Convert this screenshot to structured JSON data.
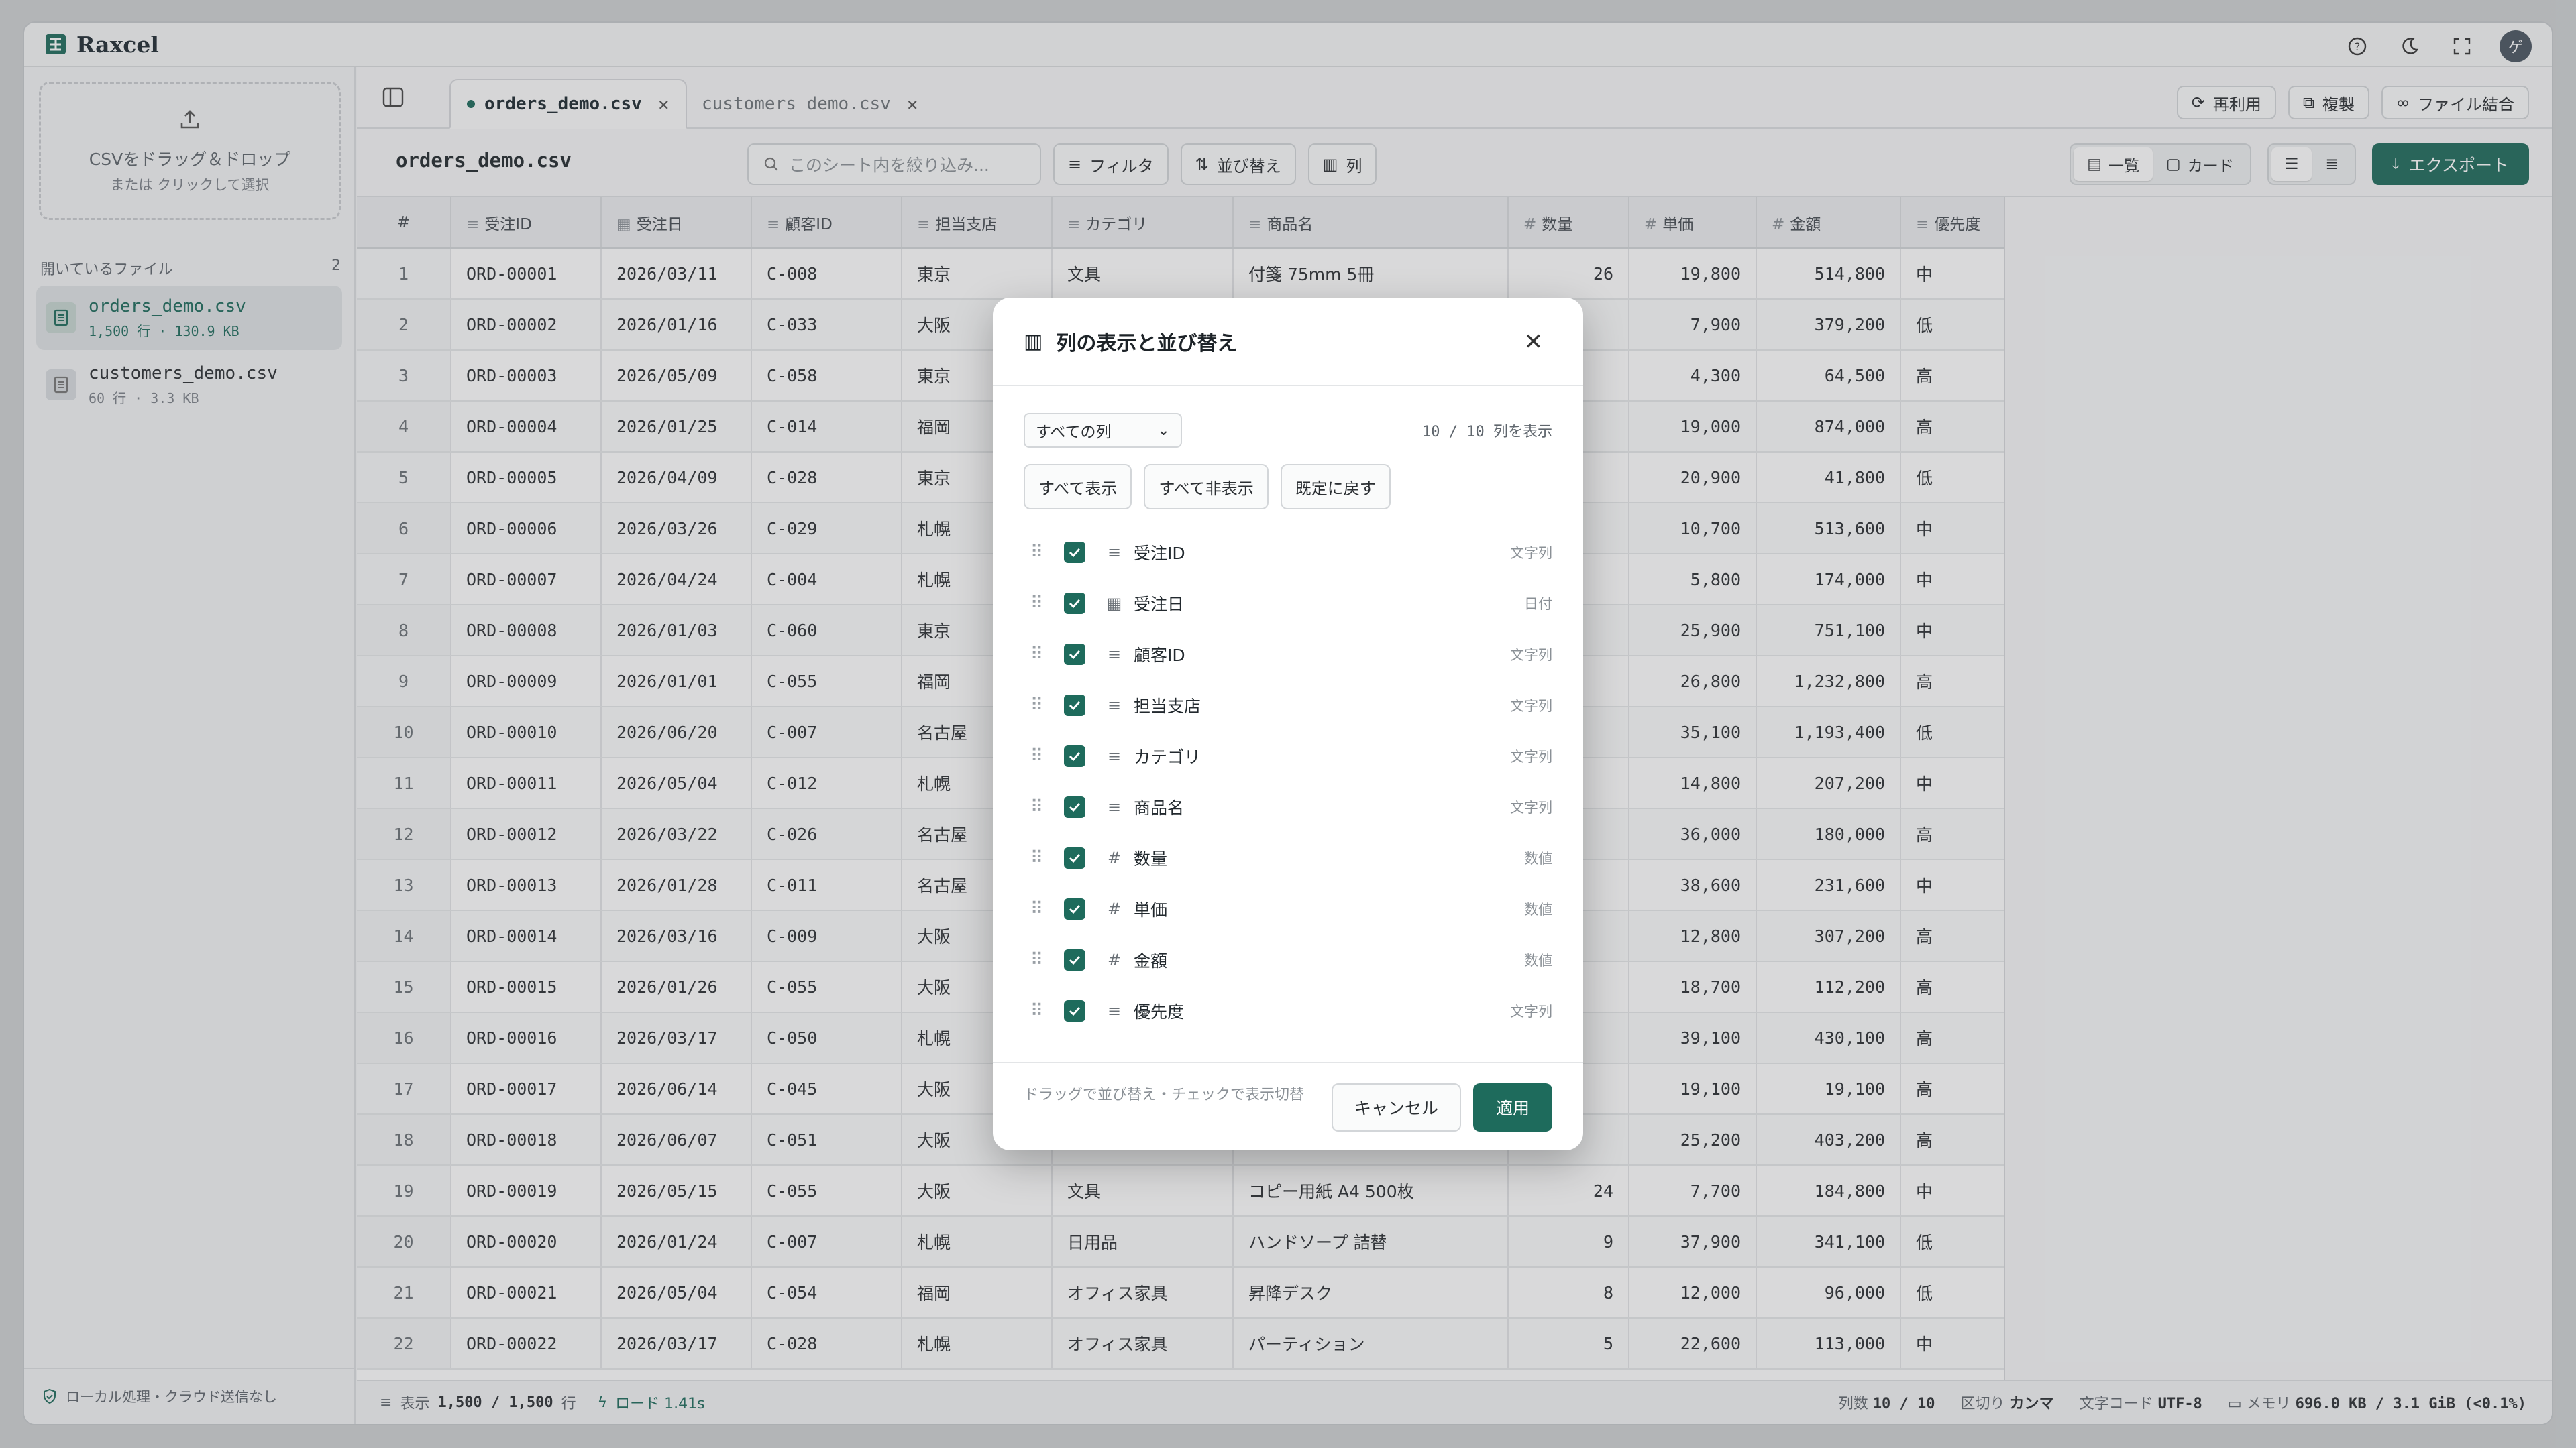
{
  "app": {
    "title": "Raxcel"
  },
  "sidebar": {
    "drop_title": "CSVをドラッグ＆ドロップ",
    "drop_sub": "または クリックして選択",
    "open_files_label": "開いているファイル",
    "open_files_count": "2",
    "files": [
      {
        "name": "orders_demo.csv",
        "meta": "1,500 行 · 130.9 KB"
      },
      {
        "name": "customers_demo.csv",
        "meta": "60 行 · 3.3 KB"
      }
    ],
    "footer": "ローカル処理・クラウド送信なし"
  },
  "tabs": [
    {
      "label": "orders_demo.csv"
    },
    {
      "label": "customers_demo.csv"
    }
  ],
  "tab_actions": {
    "reuse": "再利用",
    "duplicate": "複製",
    "merge": "ファイル結合"
  },
  "toolbar": {
    "sheet_title": "orders_demo.csv",
    "search_placeholder": "このシート内を絞り込み...",
    "filter": "フィルタ",
    "sort": "並び替え",
    "columns": "列",
    "view_list": "一覧",
    "view_card": "カード",
    "export": "エクスポート"
  },
  "table": {
    "headers": [
      "#",
      "受注ID",
      "受注日",
      "顧客ID",
      "担当支店",
      "カテゴリ",
      "商品名",
      "数量",
      "単価",
      "金額",
      "優先度"
    ],
    "rows": [
      [
        "1",
        "ORD-00001",
        "2026/03/11",
        "C-008",
        "東京",
        "文具",
        "付箋 75mm 5冊",
        "26",
        "19,800",
        "514,800",
        "中"
      ],
      [
        "2",
        "ORD-00002",
        "2026/01/16",
        "C-033",
        "大阪",
        "",
        "",
        "",
        "7,900",
        "379,200",
        "低"
      ],
      [
        "3",
        "ORD-00003",
        "2026/05/09",
        "C-058",
        "東京",
        "",
        "",
        "",
        "4,300",
        "64,500",
        "高"
      ],
      [
        "4",
        "ORD-00004",
        "2026/01/25",
        "C-014",
        "福岡",
        "",
        "",
        "",
        "19,000",
        "874,000",
        "高"
      ],
      [
        "5",
        "ORD-00005",
        "2026/04/09",
        "C-028",
        "東京",
        "",
        "",
        "",
        "20,900",
        "41,800",
        "低"
      ],
      [
        "6",
        "ORD-00006",
        "2026/03/26",
        "C-029",
        "札幌",
        "",
        "",
        "",
        "10,700",
        "513,600",
        "中"
      ],
      [
        "7",
        "ORD-00007",
        "2026/04/24",
        "C-004",
        "札幌",
        "",
        "",
        "",
        "5,800",
        "174,000",
        "中"
      ],
      [
        "8",
        "ORD-00008",
        "2026/01/03",
        "C-060",
        "東京",
        "",
        "",
        "",
        "25,900",
        "751,100",
        "中"
      ],
      [
        "9",
        "ORD-00009",
        "2026/01/01",
        "C-055",
        "福岡",
        "",
        "",
        "",
        "26,800",
        "1,232,800",
        "高"
      ],
      [
        "10",
        "ORD-00010",
        "2026/06/20",
        "C-007",
        "名古屋",
        "",
        "",
        "",
        "35,100",
        "1,193,400",
        "低"
      ],
      [
        "11",
        "ORD-00011",
        "2026/05/04",
        "C-012",
        "札幌",
        "",
        "",
        "",
        "14,800",
        "207,200",
        "中"
      ],
      [
        "12",
        "ORD-00012",
        "2026/03/22",
        "C-026",
        "名古屋",
        "",
        "",
        "",
        "36,000",
        "180,000",
        "高"
      ],
      [
        "13",
        "ORD-00013",
        "2026/01/28",
        "C-011",
        "名古屋",
        "",
        "",
        "",
        "38,600",
        "231,600",
        "中"
      ],
      [
        "14",
        "ORD-00014",
        "2026/03/16",
        "C-009",
        "大阪",
        "",
        "",
        "",
        "12,800",
        "307,200",
        "高"
      ],
      [
        "15",
        "ORD-00015",
        "2026/01/26",
        "C-055",
        "大阪",
        "",
        "",
        "",
        "18,700",
        "112,200",
        "高"
      ],
      [
        "16",
        "ORD-00016",
        "2026/03/17",
        "C-050",
        "札幌",
        "",
        "",
        "",
        "39,100",
        "430,100",
        "高"
      ],
      [
        "17",
        "ORD-00017",
        "2026/06/14",
        "C-045",
        "大阪",
        "",
        "",
        "",
        "19,100",
        "19,100",
        "高"
      ],
      [
        "18",
        "ORD-00018",
        "2026/06/07",
        "C-051",
        "大阪",
        "",
        "",
        "",
        "25,200",
        "403,200",
        "高"
      ],
      [
        "19",
        "ORD-00019",
        "2026/05/15",
        "C-055",
        "大阪",
        "文具",
        "コピー用紙 A4 500枚",
        "24",
        "7,700",
        "184,800",
        "中"
      ],
      [
        "20",
        "ORD-00020",
        "2026/01/24",
        "C-007",
        "札幌",
        "日用品",
        "ハンドソープ 詰替",
        "9",
        "37,900",
        "341,100",
        "低"
      ],
      [
        "21",
        "ORD-00021",
        "2026/05/04",
        "C-054",
        "福岡",
        "オフィス家具",
        "昇降デスク",
        "8",
        "12,000",
        "96,000",
        "低"
      ],
      [
        "22",
        "ORD-00022",
        "2026/03/17",
        "C-028",
        "札幌",
        "オフィス家具",
        "パーティション",
        "5",
        "22,600",
        "113,000",
        "中"
      ]
    ]
  },
  "status": {
    "display_label": "表示",
    "display_value": "1,500 / 1,500",
    "rows_unit": "行",
    "load": "ロード 1.41s",
    "cols_label": "列数",
    "cols_value": "10 / 10",
    "delim_label": "区切り",
    "delim_value": "カンマ",
    "enc_label": "文字コード",
    "enc_value": "UTF-8",
    "mem_label": "メモリ",
    "mem_value": "696.0 KB / 3.1 GiB (<0.1%)"
  },
  "dialog": {
    "title": "列の表示と並び替え",
    "select_value": "すべての列",
    "count": "10 / 10 列を表示",
    "show_all": "すべて表示",
    "hide_all": "すべて非表示",
    "reset": "既定に戻す",
    "columns": [
      {
        "name": "受注ID",
        "type": "文字列",
        "icon": "text-icon"
      },
      {
        "name": "受注日",
        "type": "日付",
        "icon": "calendar-icon"
      },
      {
        "name": "顧客ID",
        "type": "文字列",
        "icon": "text-icon"
      },
      {
        "name": "担当支店",
        "type": "文字列",
        "icon": "text-icon"
      },
      {
        "name": "カテゴリ",
        "type": "文字列",
        "icon": "text-icon"
      },
      {
        "name": "商品名",
        "type": "文字列",
        "icon": "text-icon"
      },
      {
        "name": "数量",
        "type": "数値",
        "icon": "hash-icon"
      },
      {
        "name": "単価",
        "type": "数値",
        "icon": "hash-icon"
      },
      {
        "name": "金額",
        "type": "数値",
        "icon": "hash-icon"
      },
      {
        "name": "優先度",
        "type": "文字列",
        "icon": "text-icon"
      }
    ],
    "footer_note": "ドラッグで並び替え・チェックで表示切替",
    "cancel": "キャンセル",
    "apply": "適用"
  },
  "colors": {
    "accent": "#1e6b5c"
  }
}
